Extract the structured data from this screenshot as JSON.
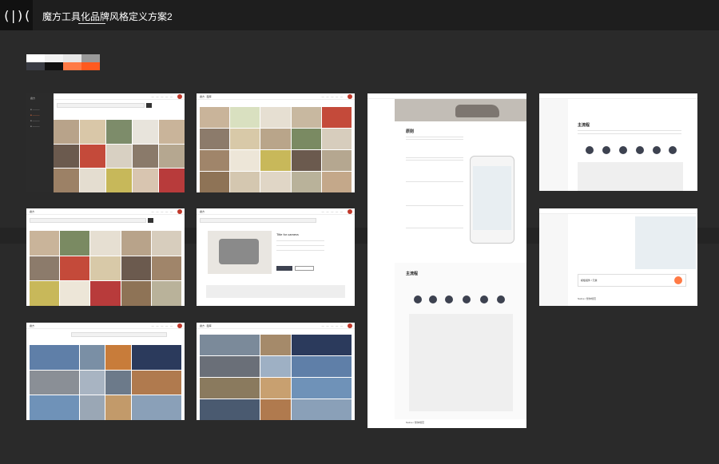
{
  "header": {
    "logo_text": "(|)(",
    "title": "魔方工具化品牌风格定义方案2"
  },
  "palette": {
    "top": [
      "#ffffff",
      "#f2f2f2",
      "#e6e6e6",
      "#9a9a9a"
    ],
    "bottom": [
      "#3a3c44",
      "#111111",
      "#ff7a45",
      "#ff5a1f"
    ]
  },
  "cards": {
    "c1": {
      "brand": "魔方"
    },
    "c2": {
      "brand": "魔方 · 图库"
    },
    "c3": {
      "brand": "魔方",
      "h_rule": "原则",
      "h_flow": "主流程",
      "footer": "Native / 整体规范"
    },
    "c4": {
      "brand": "魔方",
      "h_flow": "主流程"
    },
    "c5": {
      "brand": "魔方"
    },
    "c6": {
      "brand": "魔方",
      "product_title": "Title for camera"
    },
    "c7": {
      "brand": "魔方",
      "footer": "Native / 整体规范",
      "bar_label": "模板组件 / 元素"
    },
    "c8": {
      "brand": "魔方"
    },
    "c9": {
      "brand": "魔方 · 图库"
    }
  }
}
